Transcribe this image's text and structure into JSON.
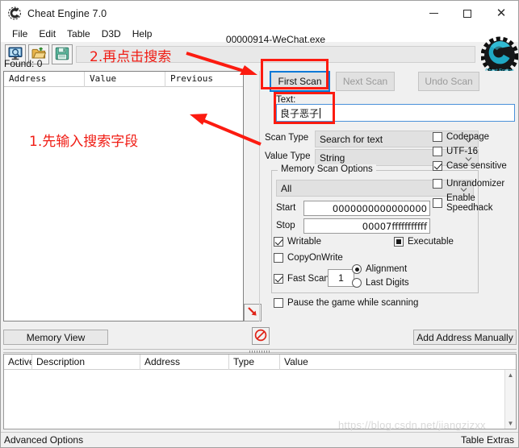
{
  "window": {
    "title": "Cheat Engine 7.0",
    "icon": "cheat-engine-logo-icon",
    "controls": {
      "minimize": "–",
      "maximize": "□",
      "close": "✕"
    }
  },
  "menubar": {
    "items": [
      {
        "label": "File"
      },
      {
        "label": "Edit"
      },
      {
        "label": "Table"
      },
      {
        "label": "D3D"
      },
      {
        "label": "Help"
      }
    ]
  },
  "toolbar": {
    "buttons": [
      {
        "name": "open-process-button",
        "icon": "monitor-icon"
      },
      {
        "name": "open-table-button",
        "icon": "open-folder-icon"
      },
      {
        "name": "save-table-button",
        "icon": "floppy-disk-icon"
      }
    ],
    "process_title": "00000914-WeChat.exe",
    "settings_label": "Settings"
  },
  "results": {
    "found_label": "Found: 0",
    "columns": [
      "Address",
      "Value",
      "Previous"
    ],
    "rows": []
  },
  "scan": {
    "first_scan_label": "First Scan",
    "next_scan_label": "Next Scan",
    "undo_scan_label": "Undo Scan",
    "text_label": "Text:",
    "text_value": "良子恶子",
    "scan_type_label": "Scan Type",
    "scan_type_value": "Search for text",
    "value_type_label": "Value Type",
    "value_type_value": "String",
    "options": {
      "group_title": "Memory Scan Options",
      "region_value": "All",
      "start_label": "Start",
      "start_value": "0000000000000000",
      "stop_label": "Stop",
      "stop_value": "00007fffffffffff",
      "writable_label": "Writable",
      "writable_checked": true,
      "executable_label": "Executable",
      "executable_state": "grayed",
      "copyonwrite_label": "CopyOnWrite",
      "copyonwrite_checked": false,
      "fast_scan_label": "Fast Scan",
      "fast_scan_checked": true,
      "fast_scan_value": "1",
      "alignment_label": "Alignment",
      "alignment_selected": true,
      "last_digits_label": "Last Digits",
      "last_digits_selected": false,
      "pause_label": "Pause the game while scanning",
      "pause_checked": false
    },
    "flags": [
      {
        "label": "Codepage",
        "checked": false
      },
      {
        "label": "UTF-16",
        "checked": false
      },
      {
        "label": "Case sensitive",
        "checked": true
      },
      {
        "label": "Unrandomizer",
        "checked": false
      },
      {
        "label": "Enable Speedhack",
        "checked": false
      }
    ]
  },
  "midbar": {
    "memory_view_label": "Memory View",
    "add_address_label": "Add Address Manually",
    "arrow_icon": "red-arrow-down-right-icon",
    "deny_icon": "red-no-entry-icon"
  },
  "cheat_table": {
    "columns": [
      "Active",
      "Description",
      "Address",
      "Type",
      "Value"
    ],
    "rows": []
  },
  "statusbar": {
    "left_label": "Advanced Options",
    "right_label": "Table Extras"
  },
  "annotations": [
    {
      "id": "step2",
      "text": "2.再点击搜索",
      "color": "#f01c14"
    },
    {
      "id": "step1",
      "text": "1.先输入搜索字段",
      "color": "#f01c14"
    }
  ],
  "watermark": {
    "text": "https://blog.csdn.net/jiangzizxx"
  }
}
